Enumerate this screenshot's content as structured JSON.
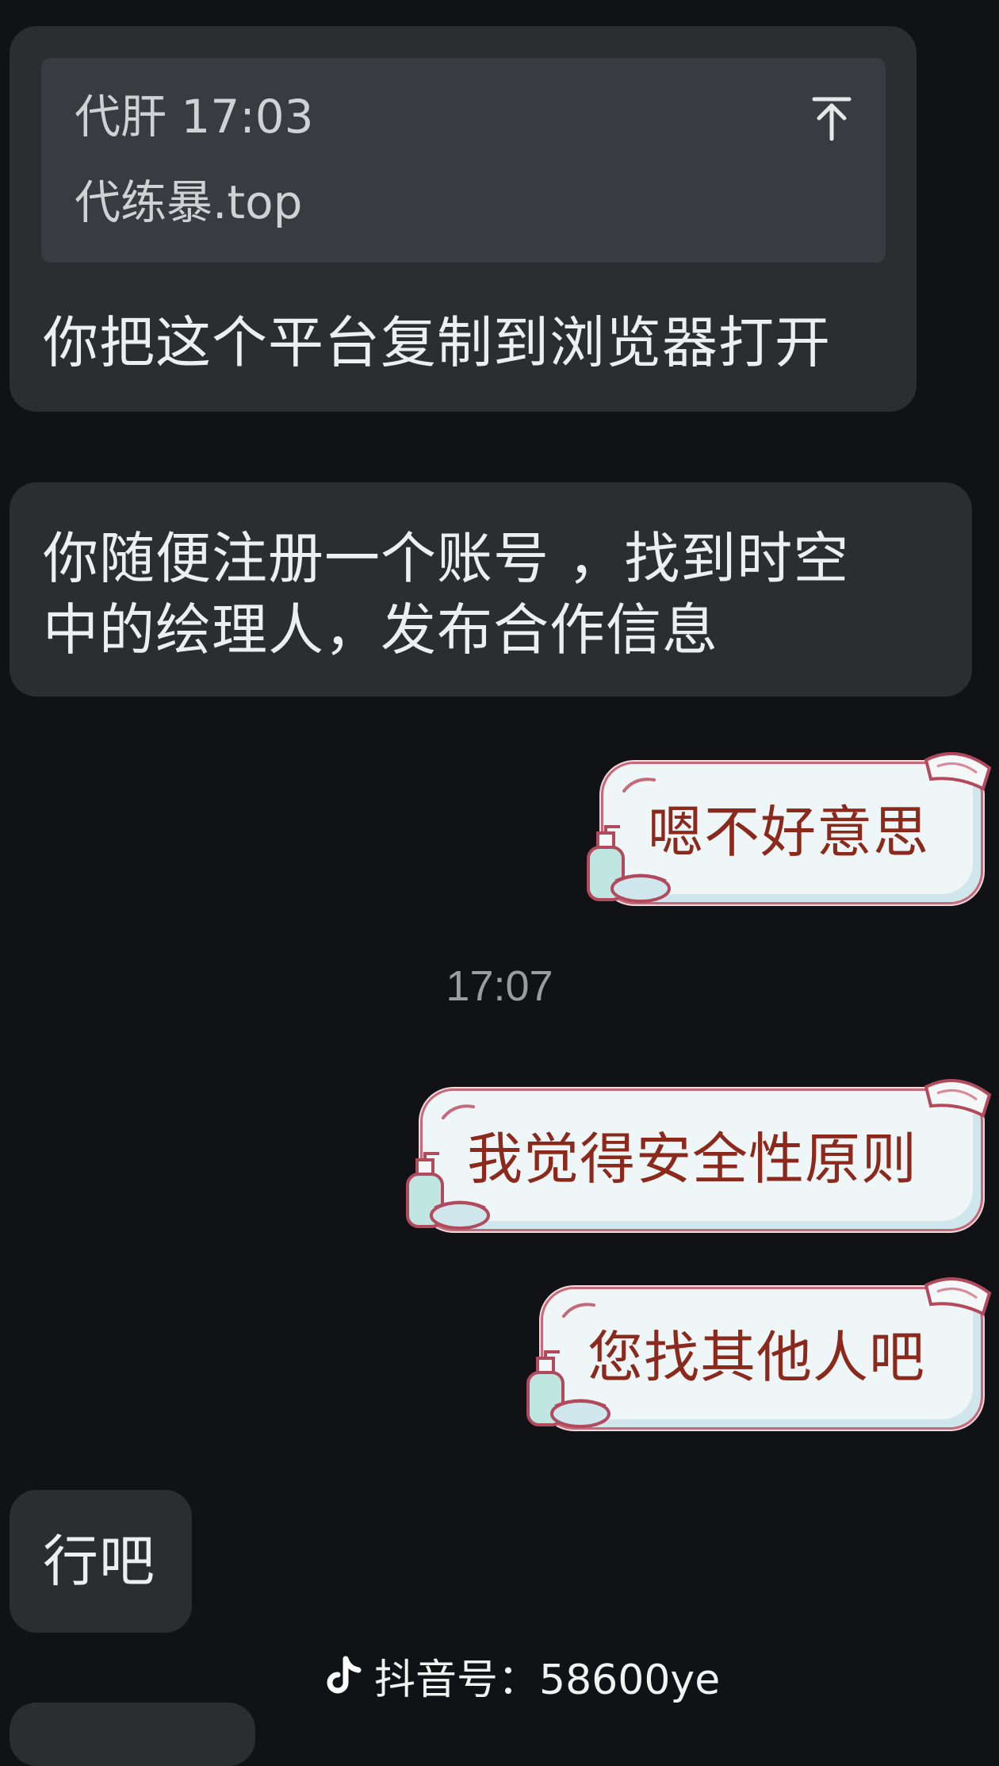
{
  "messages": {
    "m1": {
      "quote_sender_time": "代肝 17:03",
      "quote_text": "代练暴.top",
      "text": "你把这个平台复制到浏览器打开"
    },
    "m2": {
      "line1": "你随便注册一个账号 ，找到时空",
      "line2": "中的绘理人，发布合作信息"
    },
    "m3": {
      "text": "嗯不好意思"
    },
    "timestamp": "17:07",
    "m4": {
      "text": "我觉得安全性原则"
    },
    "m5": {
      "text": "您找其他人吧"
    },
    "m6": {
      "text": "行吧"
    }
  },
  "watermark": {
    "text": "抖音号：58600ye"
  },
  "colors": {
    "background": "#111216",
    "incoming_bubble": "#2c2d31",
    "outgoing_bubble": "#eef6f8",
    "outgoing_text": "#8b2a1c"
  }
}
